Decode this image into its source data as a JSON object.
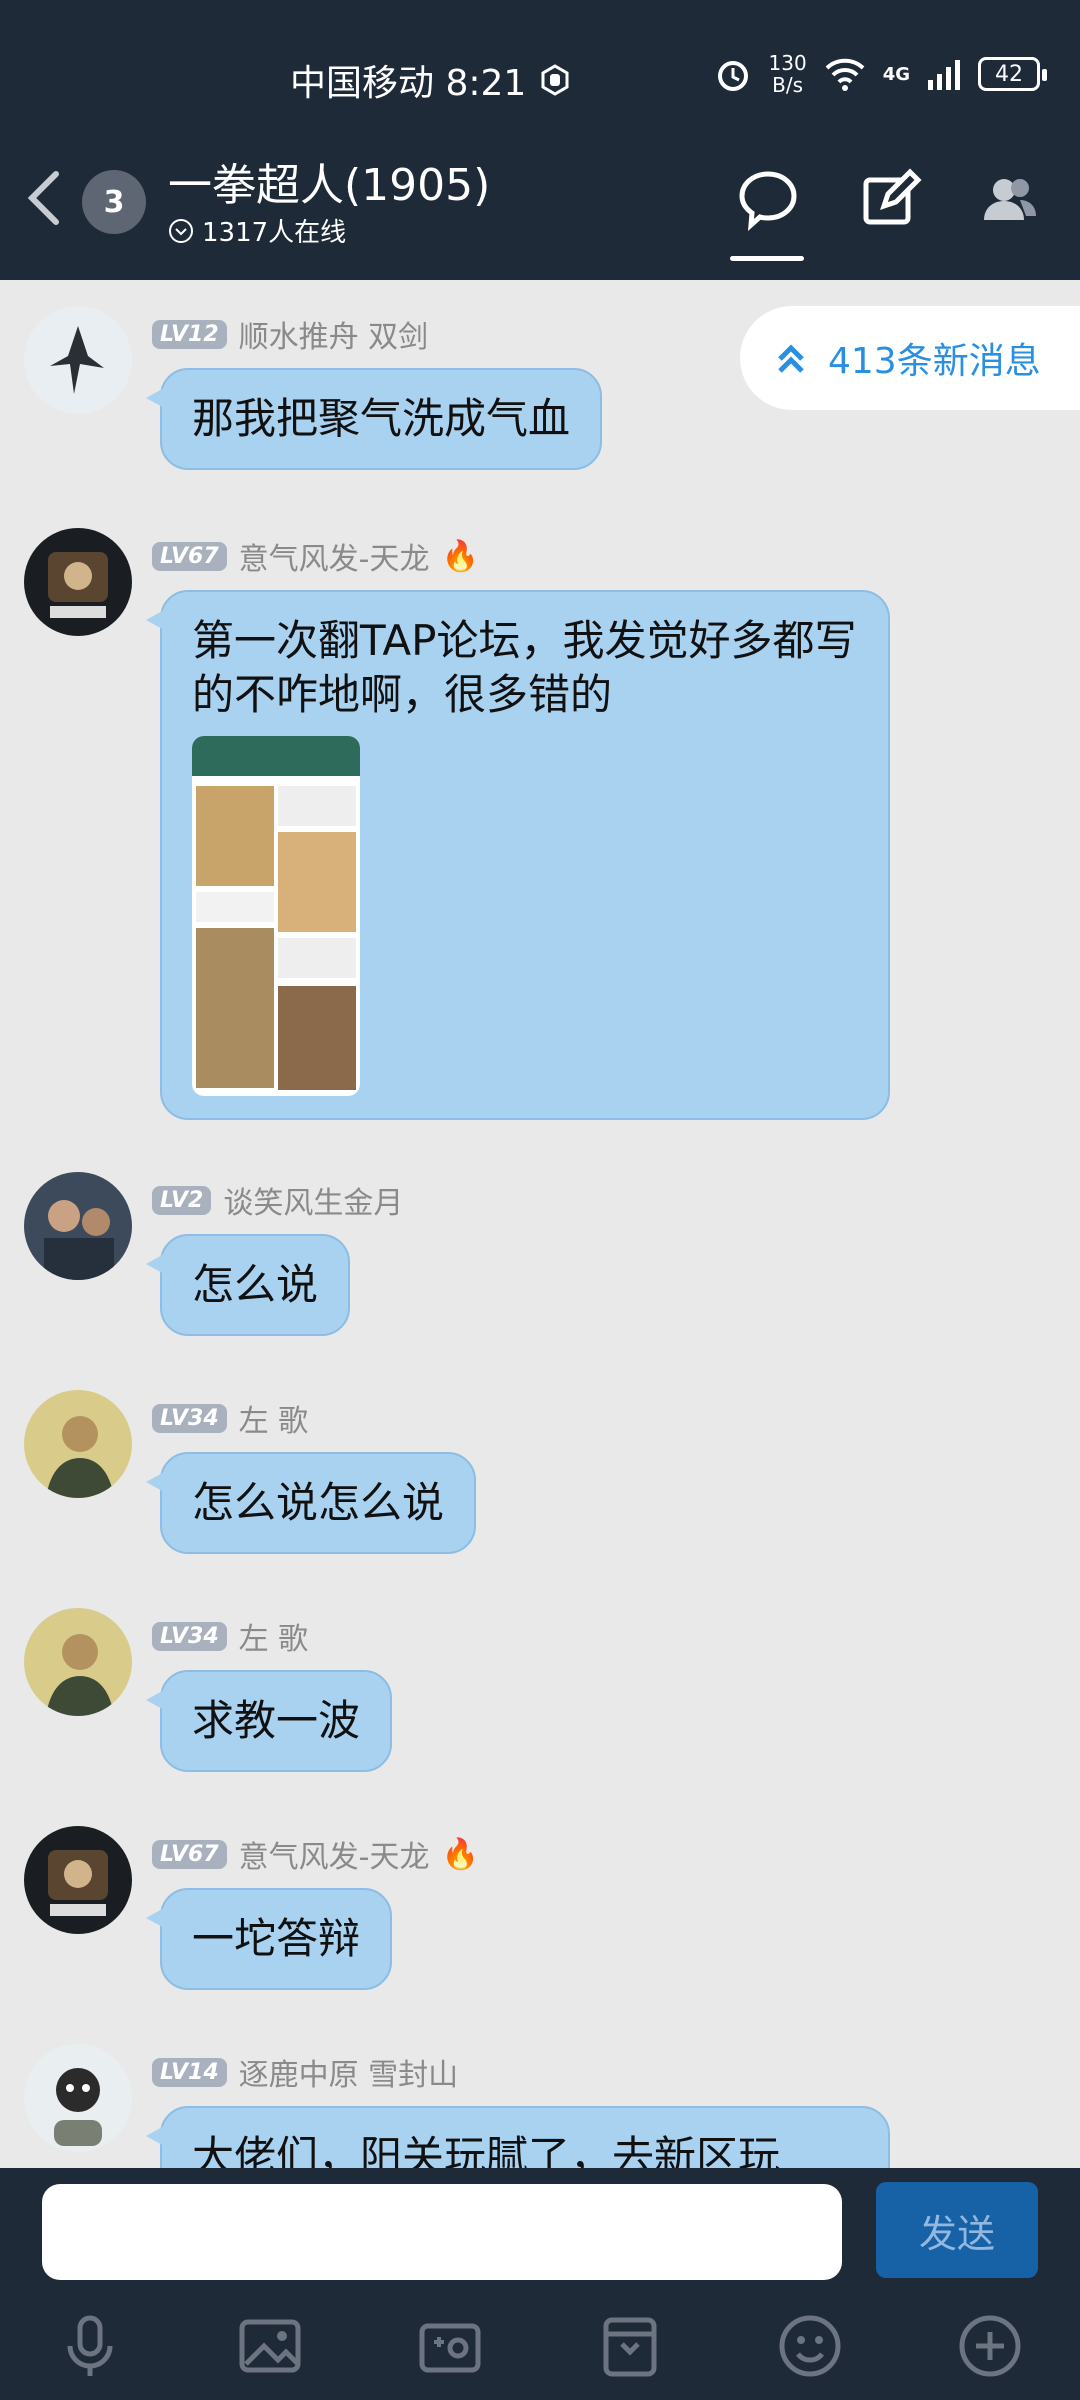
{
  "status_bar": {
    "carrier_time": "中国移动 8:21",
    "speed_top": "130",
    "speed_bottom": "B/s",
    "signal": "4G",
    "battery": "42"
  },
  "header": {
    "back_icon": "back-arrow-icon",
    "badge_count": "3",
    "title": "一拳超人(1905)",
    "online": "1317人在线"
  },
  "new_messages": {
    "label": "413条新消息"
  },
  "messages": [
    {
      "level": "LV12",
      "name": "顺水推舟 双剑",
      "text": "那我把聚气洗成气血"
    },
    {
      "level": "LV67",
      "name": "意气风发-天龙",
      "text": "第一次翻TAP论坛，我发觉好多都写的不咋地啊，很多错的"
    },
    {
      "level": "LV2",
      "name": "谈笑风生金月",
      "text": "怎么说"
    },
    {
      "level": "LV34",
      "name": "左 歌",
      "text": "怎么说怎么说"
    },
    {
      "level": "LV34",
      "name": "左 歌",
      "text": "求教一波"
    },
    {
      "level": "LV67",
      "name": "意气风发-天龙",
      "text": "一坨答辩"
    },
    {
      "level": "LV14",
      "name": "逐鹿中原 雪封山",
      "text": "大佬们，阳关玩腻了，去新区玩"
    }
  ],
  "composer": {
    "send_label": "发送",
    "placeholder": ""
  },
  "toolbar_icons": [
    "mic-icon",
    "image-icon",
    "camera-icon",
    "file-icon",
    "emoji-icon",
    "plus-icon"
  ],
  "colors": {
    "bar": "#1f2a38",
    "bubble": "#a9d1f0",
    "accent": "#2a8fe0"
  }
}
